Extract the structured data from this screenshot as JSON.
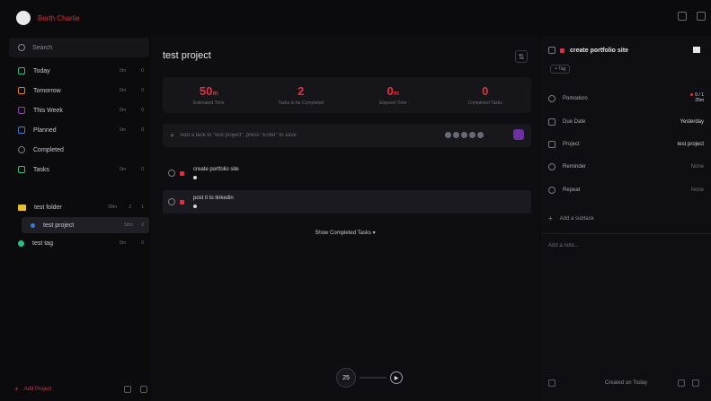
{
  "user": {
    "name": "Berth Charlie"
  },
  "search": {
    "placeholder": "Search"
  },
  "nav": [
    {
      "label": "Today",
      "count": "0m",
      "tasks": "0",
      "color": "#26c281"
    },
    {
      "label": "Tomorrow",
      "count": "0m",
      "tasks": "0",
      "color": "#e67e22"
    },
    {
      "label": "This Week",
      "count": "0m",
      "tasks": "0",
      "color": "#8e44ad"
    },
    {
      "label": "Planned",
      "count": "0m",
      "tasks": "0",
      "color": "#3a7bd5"
    },
    {
      "label": "Completed",
      "count": "",
      "tasks": "",
      "color": "#7a7a84"
    },
    {
      "label": "Tasks",
      "count": "0m",
      "tasks": "0",
      "color": "#26c281"
    }
  ],
  "folders": [
    {
      "label": "test folder",
      "count": "58m",
      "tasks": "2",
      "extra": "1"
    }
  ],
  "projects": [
    {
      "label": "test project",
      "count": "58m",
      "tasks": "2",
      "color": "#3a7bd5"
    }
  ],
  "tags": [
    {
      "label": "test tag",
      "count": "0m",
      "tasks": "0"
    }
  ],
  "sidebar_footer": {
    "label": "Add Project"
  },
  "main": {
    "title": "test project",
    "stats": [
      {
        "value": "50",
        "unit": "m",
        "label": "Estimated Time"
      },
      {
        "value": "2",
        "unit": "",
        "label": "Tasks to be Completed"
      },
      {
        "value": "0",
        "unit": "m",
        "label": "Elapsed Time"
      },
      {
        "value": "0",
        "unit": "",
        "label": "Completed Tasks"
      }
    ],
    "add_task": {
      "placeholder": "Add a task to \"test project\", press \"Enter\" to save"
    },
    "tasks": [
      {
        "title": "create portfolio site"
      },
      {
        "title": "post it to linkedin"
      }
    ],
    "show_completed": "Show Completed Tasks ▾"
  },
  "timer": {
    "value": "25",
    "button": "▶"
  },
  "detail": {
    "title": "create portfolio site",
    "tag_button": "+ Tag",
    "rows": [
      {
        "label": "Pomodoro",
        "value": ""
      },
      {
        "label": "Due Date",
        "value": "Yesterday"
      },
      {
        "label": "Project",
        "value": "test project"
      },
      {
        "label": "Reminder",
        "value": "None"
      },
      {
        "label": "Repeat",
        "value": "None"
      }
    ],
    "pomodoro": {
      "line1": "0 / 1",
      "line2": "25m"
    },
    "add_subtask": "Add a subtask",
    "note_placeholder": "Add a note...",
    "footer": "Created on Today"
  }
}
